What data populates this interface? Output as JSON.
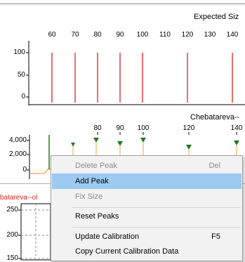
{
  "expected_panel": {
    "title": "Expected Siz",
    "x_ticks": [
      "60",
      "70",
      "80",
      "90",
      "100",
      "110",
      "120",
      "130",
      "140"
    ],
    "y_ticks": [
      "100",
      "50",
      "0"
    ],
    "peak_color": "#e02020"
  },
  "sample_panel": {
    "title": "Chebatareva--",
    "x_ticks": [
      "80",
      "90",
      "100",
      "120",
      "140"
    ],
    "y_ticks": [
      "4,000",
      "2,000",
      "0"
    ],
    "trace_color": "#f0a040",
    "marker_color": "#1e7a1e"
  },
  "lower_panel": {
    "title": "batareva--ol",
    "y_ticks": [
      "250",
      "200",
      "150"
    ]
  },
  "context_menu": {
    "items": [
      {
        "label": "Delete Peak",
        "shortcut": "Del",
        "disabled": true
      },
      {
        "label": "Add Peak",
        "shortcut": "",
        "highlighted": true
      },
      {
        "label": "Fix Size",
        "shortcut": "",
        "disabled": true
      },
      {
        "label": "Reset Peaks",
        "shortcut": ""
      },
      {
        "label": "Update Calibration",
        "shortcut": "F5"
      },
      {
        "label": "Copy Current Calibration Data",
        "shortcut": ""
      }
    ]
  }
}
